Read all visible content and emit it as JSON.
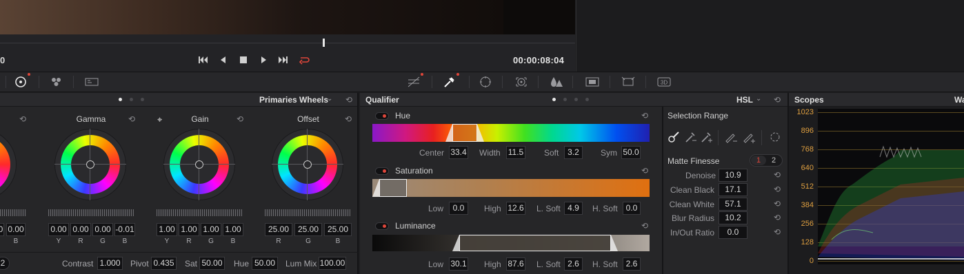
{
  "viewer": {
    "timecode": "00:00:08:04",
    "left_timecode_fragment": "0"
  },
  "transport": {
    "skip_back_icon": "skip-to-start-icon",
    "prev_icon": "play-reverse-icon",
    "stop_icon": "stop-icon",
    "play_icon": "play-icon",
    "skip_fwd_icon": "skip-to-end-icon",
    "loop_icon": "loop-icon",
    "loop_color": "#e0463a"
  },
  "primaries": {
    "panel_title": "Primaries Wheels",
    "wheels": [
      {
        "label": "Gamma",
        "values": [
          "0.00",
          "0.00",
          "0.00",
          "-0.01"
        ],
        "channels": [
          "Y",
          "R",
          "G",
          "B"
        ]
      },
      {
        "label": "Gain",
        "values": [
          "1.00",
          "1.00",
          "1.00",
          "1.00"
        ],
        "channels": [
          "Y",
          "R",
          "G",
          "B"
        ]
      },
      {
        "label": "Offset",
        "values": [
          "25.00",
          "25.00",
          "25.00"
        ],
        "channels": [
          "R",
          "G",
          "B"
        ]
      }
    ],
    "partial_left": {
      "values": [
        "0",
        "0.00"
      ],
      "channel": "B"
    },
    "bottom": {
      "left_fragment": "2",
      "contrast_label": "Contrast",
      "contrast": "1.000",
      "pivot_label": "Pivot",
      "pivot": "0.435",
      "sat_label": "Sat",
      "sat": "50.00",
      "hue_label": "Hue",
      "hue": "50.00",
      "lummix_label": "Lum Mix",
      "lummix": "100.00"
    }
  },
  "qualifier": {
    "title": "Qualifier",
    "mode": "HSL",
    "hue": {
      "label": "Hue",
      "center_label": "Center",
      "center": "33.4",
      "width_label": "Width",
      "width": "11.5",
      "soft_label": "Soft",
      "soft": "3.2",
      "sym_label": "Sym",
      "sym": "50.0"
    },
    "saturation": {
      "label": "Saturation",
      "low_label": "Low",
      "low": "0.0",
      "high_label": "High",
      "high": "12.6",
      "lsoft_label": "L. Soft",
      "lsoft": "4.9",
      "hsoft_label": "H. Soft",
      "hsoft": "0.0"
    },
    "luminance": {
      "label": "Luminance",
      "low_label": "Low",
      "low": "30.1",
      "high_label": "High",
      "high": "87.6",
      "lsoft_label": "L. Soft",
      "lsoft": "2.6",
      "hsoft_label": "H. Soft",
      "hsoft": "2.6"
    }
  },
  "selection": {
    "title": "Selection Range",
    "matte_title": "Matte Finesse",
    "tabs": [
      "1",
      "2"
    ],
    "params": [
      {
        "label": "Denoise",
        "value": "10.9"
      },
      {
        "label": "Clean Black",
        "value": "17.1"
      },
      {
        "label": "Clean White",
        "value": "57.1"
      },
      {
        "label": "Blur Radius",
        "value": "10.2"
      },
      {
        "label": "In/Out Ratio",
        "value": "0.0"
      }
    ]
  },
  "scopes": {
    "title": "Scopes",
    "title_right_fragment": "Wa",
    "ticks": [
      "1023",
      "896",
      "768",
      "640",
      "512",
      "384",
      "256",
      "128",
      "0"
    ],
    "tick_color": "#e0a040"
  }
}
